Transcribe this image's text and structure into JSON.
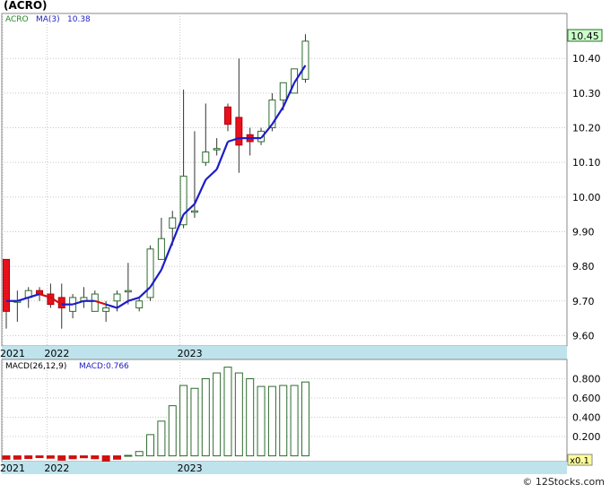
{
  "header": {
    "title": "(ACRO)",
    "price_legend_symbol": "ACRO",
    "ma_legend_label": "MA(3)",
    "ma_legend_value": "10.38",
    "last_price_tag": "10.45",
    "macd_legend_params": "MACD(26,12,9)",
    "macd_legend_value": "MACD:0.766",
    "macd_scale_tag": "x0.1"
  },
  "footer": {
    "credit": "© 12Stocks.com"
  },
  "colors": {
    "up_candle_border": "#2e6b2e",
    "down_candle_fill": "#e8101a",
    "ma_line": "#1c1cc8",
    "ma_line_below": "#d01010",
    "macd_bar_border": "#2e6b2e",
    "macd_neg_bar": "#d01010",
    "axis_band": "#bfe3ec",
    "price_tag_fill": "#ccffcc",
    "scale_tag_fill": "#ffff99"
  },
  "chart_data": [
    {
      "type": "candlestick",
      "title": "(ACRO)",
      "y_ticks": [
        "9.60",
        "9.70",
        "9.80",
        "9.90",
        "10.00",
        "10.10",
        "10.20",
        "10.30",
        "10.40"
      ],
      "ylim": [
        9.57,
        10.53
      ],
      "x_tick_labels": [
        {
          "label": "2021",
          "index": 0
        },
        {
          "label": "2022",
          "index": 4
        },
        {
          "label": "2023",
          "index": 16
        }
      ],
      "grid": true,
      "candles": [
        {
          "open": 9.82,
          "close": 9.67,
          "high": 9.82,
          "low": 9.62
        },
        {
          "open": 9.7,
          "close": 9.7,
          "high": 9.73,
          "low": 9.64
        },
        {
          "open": 9.71,
          "close": 9.73,
          "high": 9.74,
          "low": 9.68
        },
        {
          "open": 9.73,
          "close": 9.72,
          "high": 9.74,
          "low": 9.7
        },
        {
          "open": 9.72,
          "close": 9.69,
          "high": 9.75,
          "low": 9.68
        },
        {
          "open": 9.71,
          "close": 9.68,
          "high": 9.75,
          "low": 9.62
        },
        {
          "open": 9.67,
          "close": 9.71,
          "high": 9.72,
          "low": 9.65
        },
        {
          "open": 9.7,
          "close": 9.71,
          "high": 9.74,
          "low": 9.68
        },
        {
          "open": 9.67,
          "close": 9.72,
          "high": 9.73,
          "low": 9.67
        },
        {
          "open": 9.67,
          "close": 9.68,
          "high": 9.7,
          "low": 9.64
        },
        {
          "open": 9.7,
          "close": 9.72,
          "high": 9.73,
          "low": 9.67
        },
        {
          "open": 9.73,
          "close": 9.73,
          "high": 9.81,
          "low": 9.69
        },
        {
          "open": 9.68,
          "close": 9.7,
          "high": 9.71,
          "low": 9.67
        },
        {
          "open": 9.71,
          "close": 9.85,
          "high": 9.86,
          "low": 9.7
        },
        {
          "open": 9.82,
          "close": 9.88,
          "high": 9.94,
          "low": 9.82
        },
        {
          "open": 9.91,
          "close": 9.94,
          "high": 9.96,
          "low": 9.86
        },
        {
          "open": 9.92,
          "close": 10.06,
          "high": 10.31,
          "low": 9.91
        },
        {
          "open": 9.96,
          "close": 9.96,
          "high": 10.19,
          "low": 9.94
        },
        {
          "open": 10.1,
          "close": 10.13,
          "high": 10.27,
          "low": 10.09
        },
        {
          "open": 10.14,
          "close": 10.14,
          "high": 10.17,
          "low": 10.12
        },
        {
          "open": 10.26,
          "close": 10.21,
          "high": 10.27,
          "low": 10.19
        },
        {
          "open": 10.23,
          "close": 10.15,
          "high": 10.4,
          "low": 10.07
        },
        {
          "open": 10.18,
          "close": 10.16,
          "high": 10.2,
          "low": 10.12
        },
        {
          "open": 10.16,
          "close": 10.19,
          "high": 10.2,
          "low": 10.15
        },
        {
          "open": 10.2,
          "close": 10.28,
          "high": 10.3,
          "low": 10.19
        },
        {
          "open": 10.28,
          "close": 10.33,
          "high": 10.33,
          "low": 10.25
        },
        {
          "open": 10.3,
          "close": 10.37,
          "high": 10.37,
          "low": 10.3
        },
        {
          "open": 10.34,
          "close": 10.45,
          "high": 10.47,
          "low": 10.33
        }
      ],
      "ma3": [
        9.7,
        9.7,
        9.71,
        9.72,
        9.71,
        9.69,
        9.69,
        9.7,
        9.7,
        9.69,
        9.68,
        9.7,
        9.71,
        9.74,
        9.79,
        9.87,
        9.95,
        9.98,
        10.05,
        10.08,
        10.16,
        10.17,
        10.17,
        10.17,
        10.21,
        10.26,
        10.33,
        10.38
      ]
    },
    {
      "type": "bar",
      "title": "MACD(26,12,9)",
      "y_ticks": [
        "0.200",
        "0.400",
        "0.600",
        "0.800"
      ],
      "ylim": [
        -0.06,
        1.0
      ],
      "scale_note": "x0.1",
      "values": [
        -0.035,
        -0.035,
        -0.028,
        -0.018,
        -0.025,
        -0.045,
        -0.03,
        -0.02,
        -0.03,
        -0.06,
        -0.035,
        0.005,
        0.045,
        0.22,
        0.36,
        0.52,
        0.73,
        0.7,
        0.8,
        0.86,
        0.92,
        0.86,
        0.8,
        0.72,
        0.72,
        0.73,
        0.73,
        0.766
      ]
    }
  ]
}
